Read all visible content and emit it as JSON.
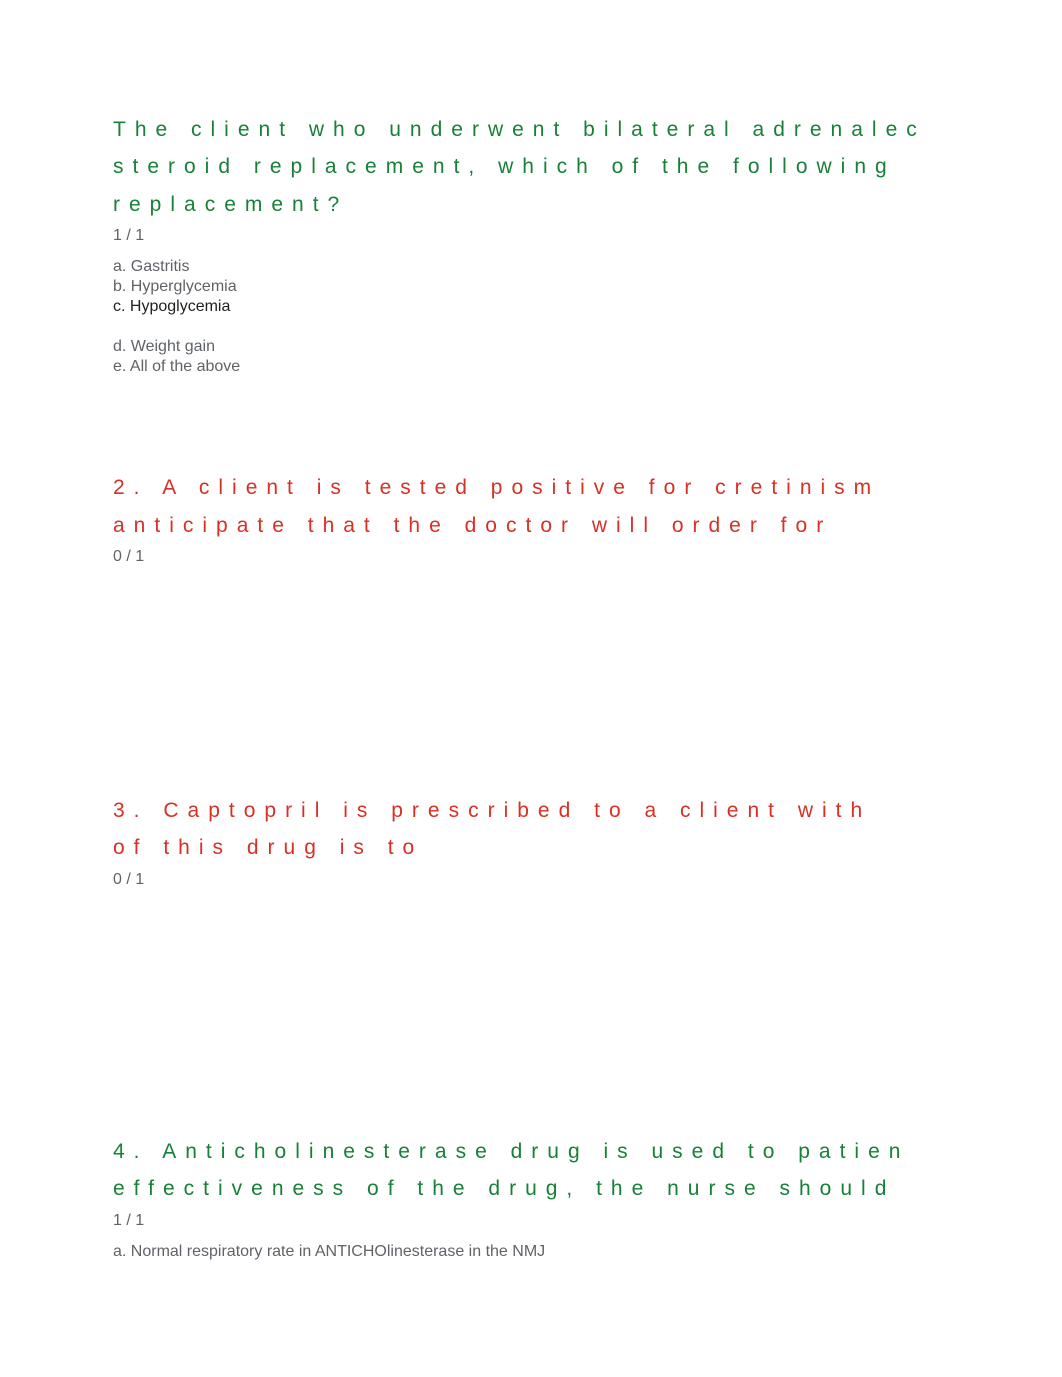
{
  "q1": {
    "line1": "The client who underwent bilateral adrenalec",
    "line2": "steroid replacement, which of the following",
    "line3": "replacement?",
    "score": "1 / 1",
    "a": "a. Gastritis",
    "b": "b. Hyperglycemia",
    "c": "c. Hypoglycemia",
    "d": "d. Weight gain",
    "e": "e. All of the above"
  },
  "q2": {
    "line1": "2. A client is tested positive for cretinism",
    "line2": "anticipate that the doctor will order for",
    "score": "0 / 1"
  },
  "q3": {
    "line1": "3. Captopril is prescribed to a client with",
    "line2": "of this drug is to",
    "score": "0 / 1"
  },
  "q4": {
    "line1": "4. Anticholinesterase drug is used to patien",
    "line2": "effectiveness of the drug, the nurse should",
    "score": "1 / 1",
    "a": "a. Normal respiratory rate   in ANTICHOlinesterase in the NMJ"
  }
}
